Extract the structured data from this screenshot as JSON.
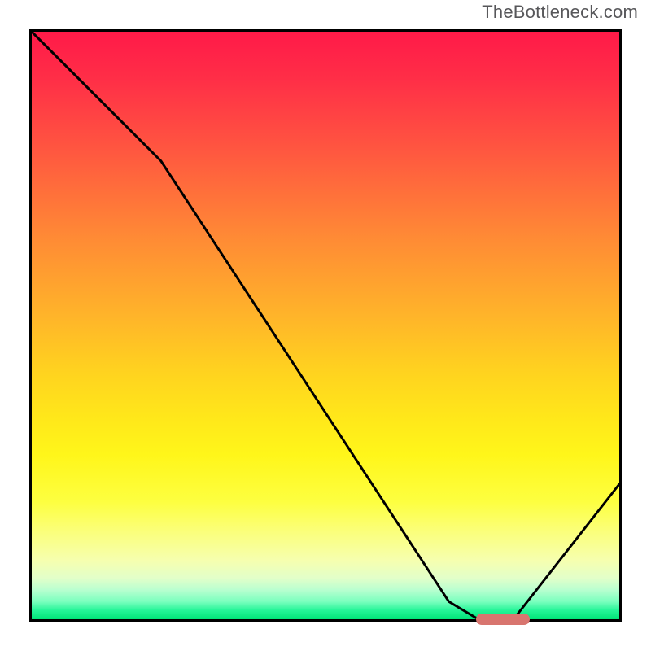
{
  "watermark": "TheBottleneck.com",
  "chart_data": {
    "type": "line",
    "title": "",
    "xlabel": "",
    "ylabel": "",
    "xlim": [
      0,
      100
    ],
    "ylim": [
      0,
      100
    ],
    "x": [
      0,
      22,
      71,
      76,
      82,
      100
    ],
    "values": [
      100,
      78,
      3,
      0,
      0,
      23
    ],
    "marker": {
      "x_start": 75,
      "x_end": 84,
      "y": 0
    },
    "gradient_stops": [
      {
        "pos": 0,
        "color": "#ff1a48"
      },
      {
        "pos": 0.35,
        "color": "#ff8a35"
      },
      {
        "pos": 0.66,
        "color": "#ffe81a"
      },
      {
        "pos": 0.9,
        "color": "#f6ffaf"
      },
      {
        "pos": 1.0,
        "color": "#00e478"
      }
    ]
  }
}
